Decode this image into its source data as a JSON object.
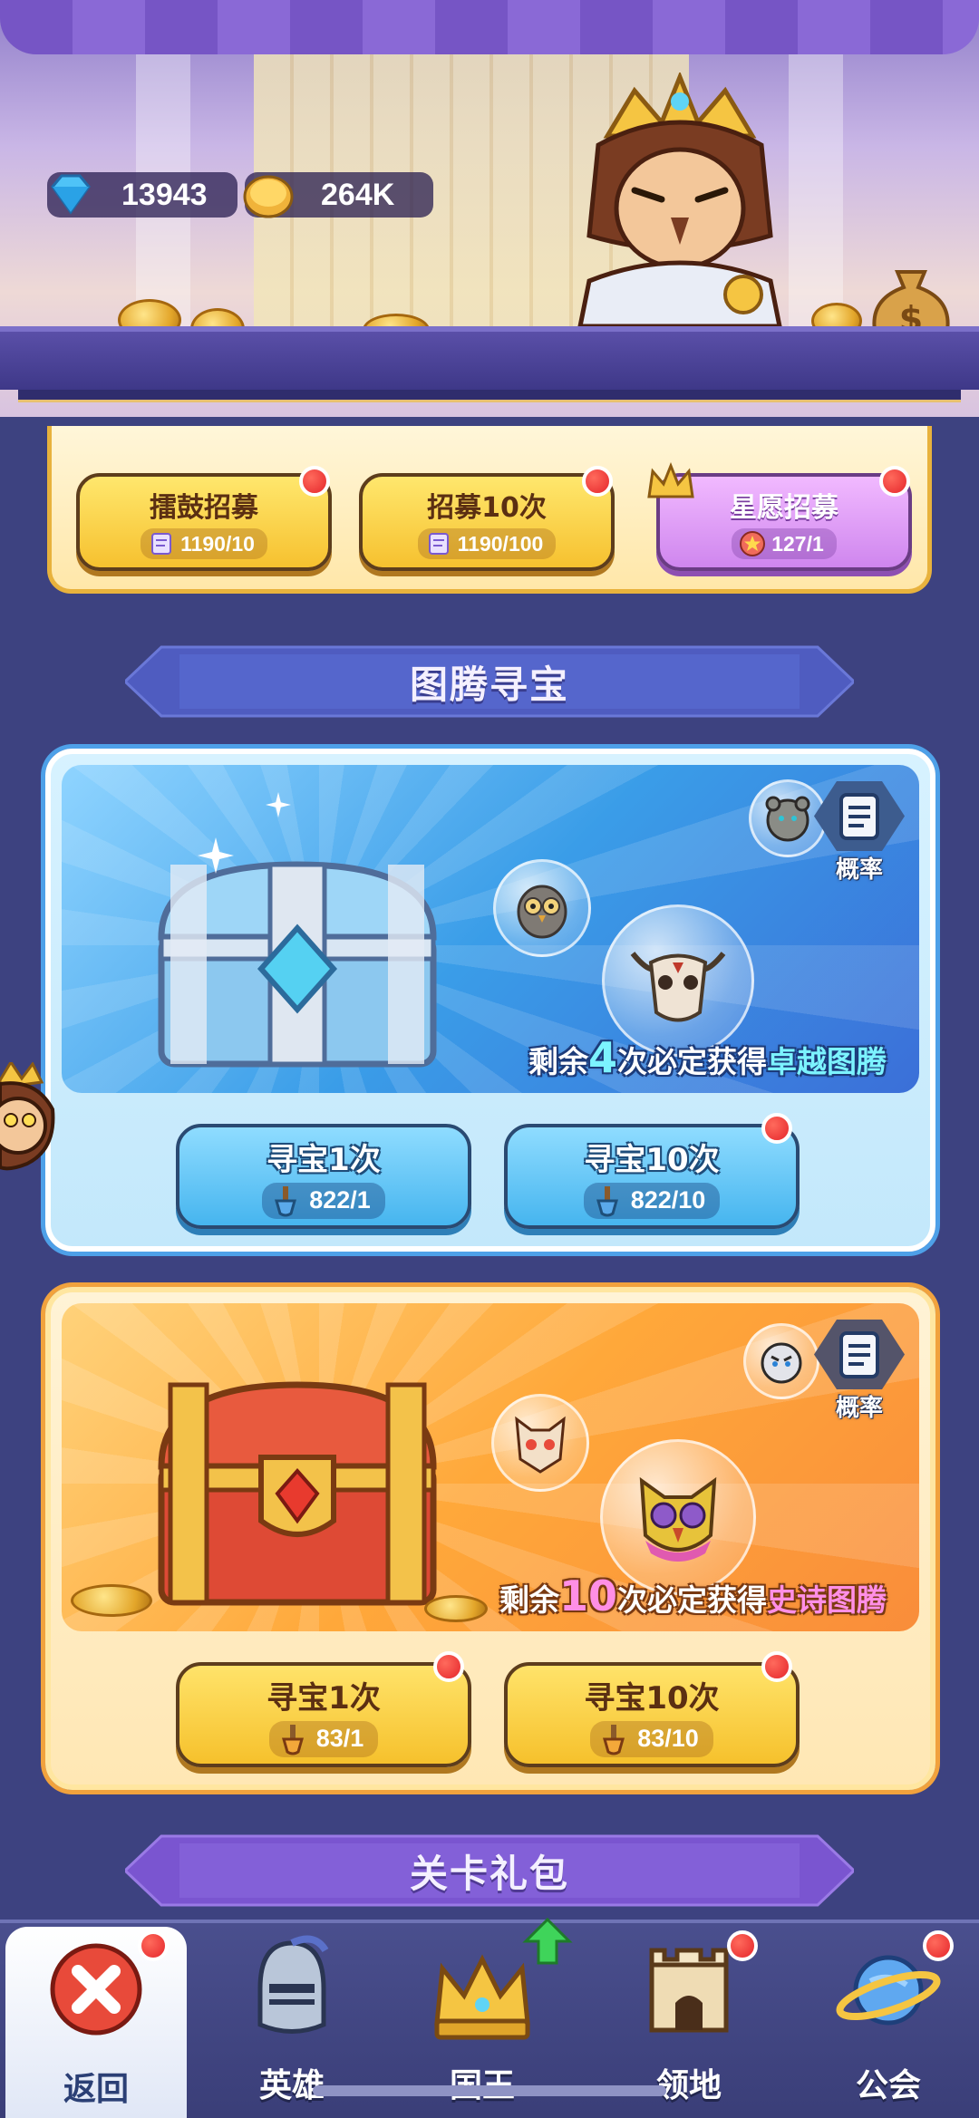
{
  "resources": {
    "diamonds": "13943",
    "gold": "264K"
  },
  "recruit": {
    "buttons": [
      {
        "label": "擂鼓招募",
        "cost": "1190/10"
      },
      {
        "label": "招募10次",
        "cost": "1190/100"
      },
      {
        "label": "星愿招募",
        "cost": "127/1"
      }
    ]
  },
  "totem_section": {
    "title": "图腾寻宝"
  },
  "chest_blue": {
    "probability_label": "概率",
    "guarantee_prefix": "剩余",
    "guarantee_count": "4",
    "guarantee_mid": "次必定获得",
    "guarantee_reward": "卓越图腾",
    "btn_single": {
      "label": "寻宝1次",
      "cost": "822/1"
    },
    "btn_ten": {
      "label": "寻宝10次",
      "cost": "822/10"
    }
  },
  "chest_orange": {
    "probability_label": "概率",
    "guarantee_prefix": "剩余",
    "guarantee_count": "10",
    "guarantee_mid": "次必定获得",
    "guarantee_reward": "史诗图腾",
    "btn_single": {
      "label": "寻宝1次",
      "cost": "83/1"
    },
    "btn_ten": {
      "label": "寻宝10次",
      "cost": "83/10"
    }
  },
  "stage_pack_section": {
    "title": "关卡礼包"
  },
  "bottom_nav": {
    "items": [
      {
        "label": "返回",
        "icon": "close-icon"
      },
      {
        "label": "英雄",
        "icon": "knight-helmet-icon"
      },
      {
        "label": "国王",
        "icon": "crown-icon"
      },
      {
        "label": "领地",
        "icon": "castle-icon"
      },
      {
        "label": "公会",
        "icon": "planet-icon"
      }
    ]
  },
  "colors": {
    "background": "#3d4280",
    "notification_red": "#e5262b",
    "ribbon_blue": "#5060c0",
    "ribbon_purple": "#7a55d0",
    "button_gold": "#f6c12f",
    "button_blue": "#46b5ef"
  }
}
